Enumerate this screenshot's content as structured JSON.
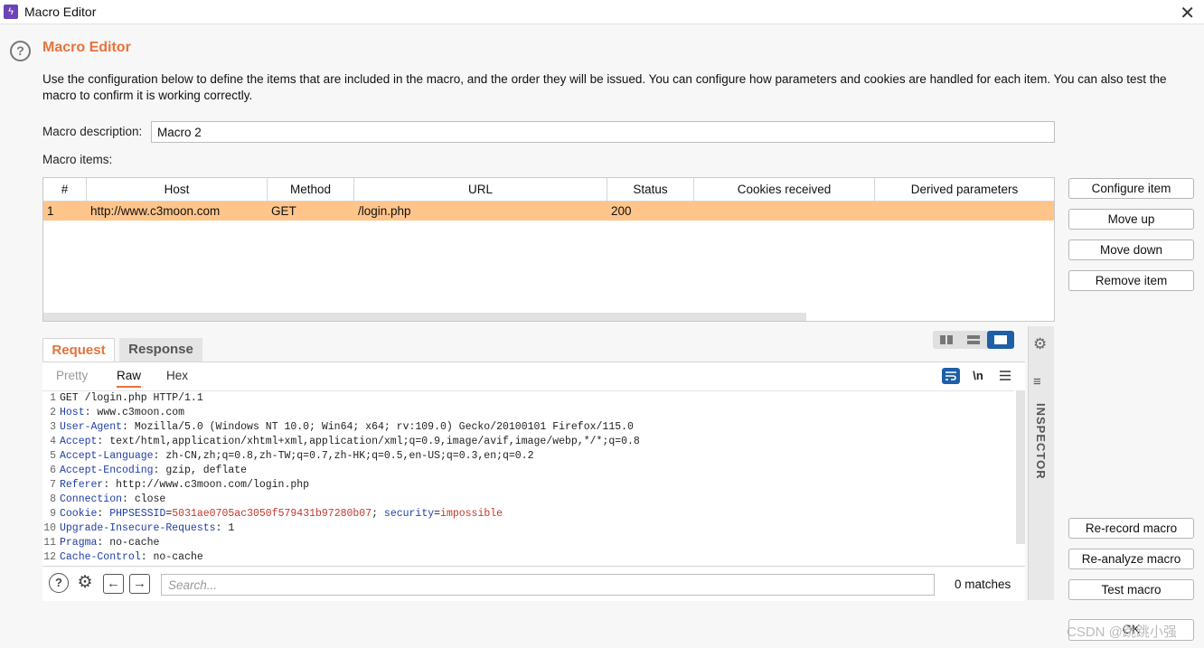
{
  "window": {
    "title": "Macro Editor",
    "app_icon": "lightning-icon",
    "close_glyph": "✕"
  },
  "header": {
    "title": "Macro Editor",
    "help_glyph": "?",
    "description": "Use the configuration below to define the items that are included in the macro, and the order they will be issued. You can configure how parameters and cookies are handled for each item. You can also test the macro to confirm it is working correctly."
  },
  "macro_description": {
    "label": "Macro description:",
    "value": "Macro 2"
  },
  "macro_items": {
    "label": "Macro items:",
    "columns": [
      "#",
      "Host",
      "Method",
      "URL",
      "Status",
      "Cookies received",
      "Derived parameters"
    ],
    "rows": [
      {
        "num": "1",
        "host": "http://www.c3moon.com",
        "method": "GET",
        "url": "/login.php",
        "status": "200",
        "cookies": "",
        "derived": ""
      }
    ],
    "selected_row_color": "#ffc48a"
  },
  "side_buttons": {
    "configure_item": "Configure item",
    "move_up": "Move up",
    "move_down": "Move down",
    "remove_item": "Remove item",
    "re_record": "Re-record macro",
    "re_analyze": "Re-analyze macro",
    "test_macro": "Test macro",
    "ok": "OK"
  },
  "editor": {
    "tabs": {
      "request": "Request",
      "response": "Response"
    },
    "subtabs": {
      "pretty": "Pretty",
      "raw": "Raw",
      "hex": "Hex"
    },
    "toolbar": {
      "newline_label": "\\n",
      "wrap_icon": "wrap-icon",
      "menu_icon": "menu-icon"
    },
    "lines": [
      {
        "n": "1",
        "key": "",
        "sep": "",
        "val": "GET /login.php HTTP/1.1"
      },
      {
        "n": "2",
        "key": "Host",
        "sep": ": ",
        "val": "www.c3moon.com"
      },
      {
        "n": "3",
        "key": "User-Agent",
        "sep": ": ",
        "val": "Mozilla/5.0 (Windows NT 10.0; Win64; x64; rv:109.0) Gecko/20100101 Firefox/115.0"
      },
      {
        "n": "4",
        "key": "Accept",
        "sep": ": ",
        "val": "text/html,application/xhtml+xml,application/xml;q=0.9,image/avif,image/webp,*/*;q=0.8"
      },
      {
        "n": "5",
        "key": "Accept-Language",
        "sep": ": ",
        "val": "zh-CN,zh;q=0.8,zh-TW;q=0.7,zh-HK;q=0.5,en-US;q=0.3,en;q=0.2"
      },
      {
        "n": "6",
        "key": "Accept-Encoding",
        "sep": ": ",
        "val": "gzip, deflate"
      },
      {
        "n": "7",
        "key": "Referer",
        "sep": ": ",
        "val": "http://www.c3moon.com/login.php"
      },
      {
        "n": "8",
        "key": "Connection",
        "sep": ": ",
        "val": "close"
      },
      {
        "n": "9",
        "key": "Cookie",
        "sep": ": ",
        "val": "",
        "cookie": true,
        "c1k": "PHPSESSID",
        "c1v": "5031ae0705ac3050f579431b97280b07",
        "c2k": "security",
        "c2v": "impossible"
      },
      {
        "n": "10",
        "key": "Upgrade-Insecure-Requests",
        "sep": ": ",
        "val": "1"
      },
      {
        "n": "11",
        "key": "Pragma",
        "sep": ": ",
        "val": "no-cache"
      },
      {
        "n": "12",
        "key": "Cache-Control",
        "sep": ": ",
        "val": "no-cache"
      }
    ],
    "search": {
      "placeholder": "Search...",
      "matches": "0 matches"
    }
  },
  "inspector": {
    "label": "INSPECTOR"
  },
  "watermark": "CSDN @跳跳小强",
  "colors": {
    "accent": "#e8733b",
    "header_key": "#1f3ea8",
    "cookie_value": "#c0392b",
    "layout_active": "#1f5fa8"
  }
}
